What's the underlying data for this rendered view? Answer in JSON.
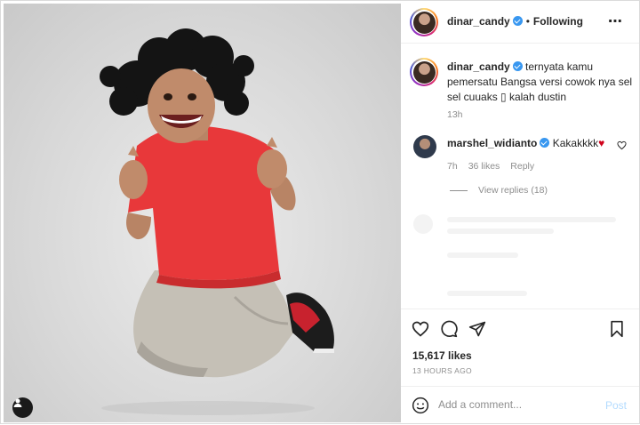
{
  "post": {
    "author": "dinar_candy",
    "follow_status": "Following",
    "separator": "•",
    "more_icon": "⋯",
    "caption_text": "ternyata kamu pemersatu Bangsa versi cowok nya sel sel cuuaks ▯ kalah dustin",
    "caption_time": "13h"
  },
  "comment": {
    "username": "marshel_widianto",
    "text": "Kakakkkk",
    "heart": "♥",
    "time": "7h",
    "likes": "36 likes",
    "reply_label": "Reply",
    "view_replies": "View replies (18)"
  },
  "stats": {
    "likes": "15,617 likes",
    "posted_ago": "13 HOURS AGO"
  },
  "add_comment": {
    "placeholder": "Add a comment...",
    "post_label": "Post"
  },
  "colors": {
    "verified": "#3897f0",
    "post_button_disabled": "#b3dbff",
    "shirt": "#e8383a"
  }
}
